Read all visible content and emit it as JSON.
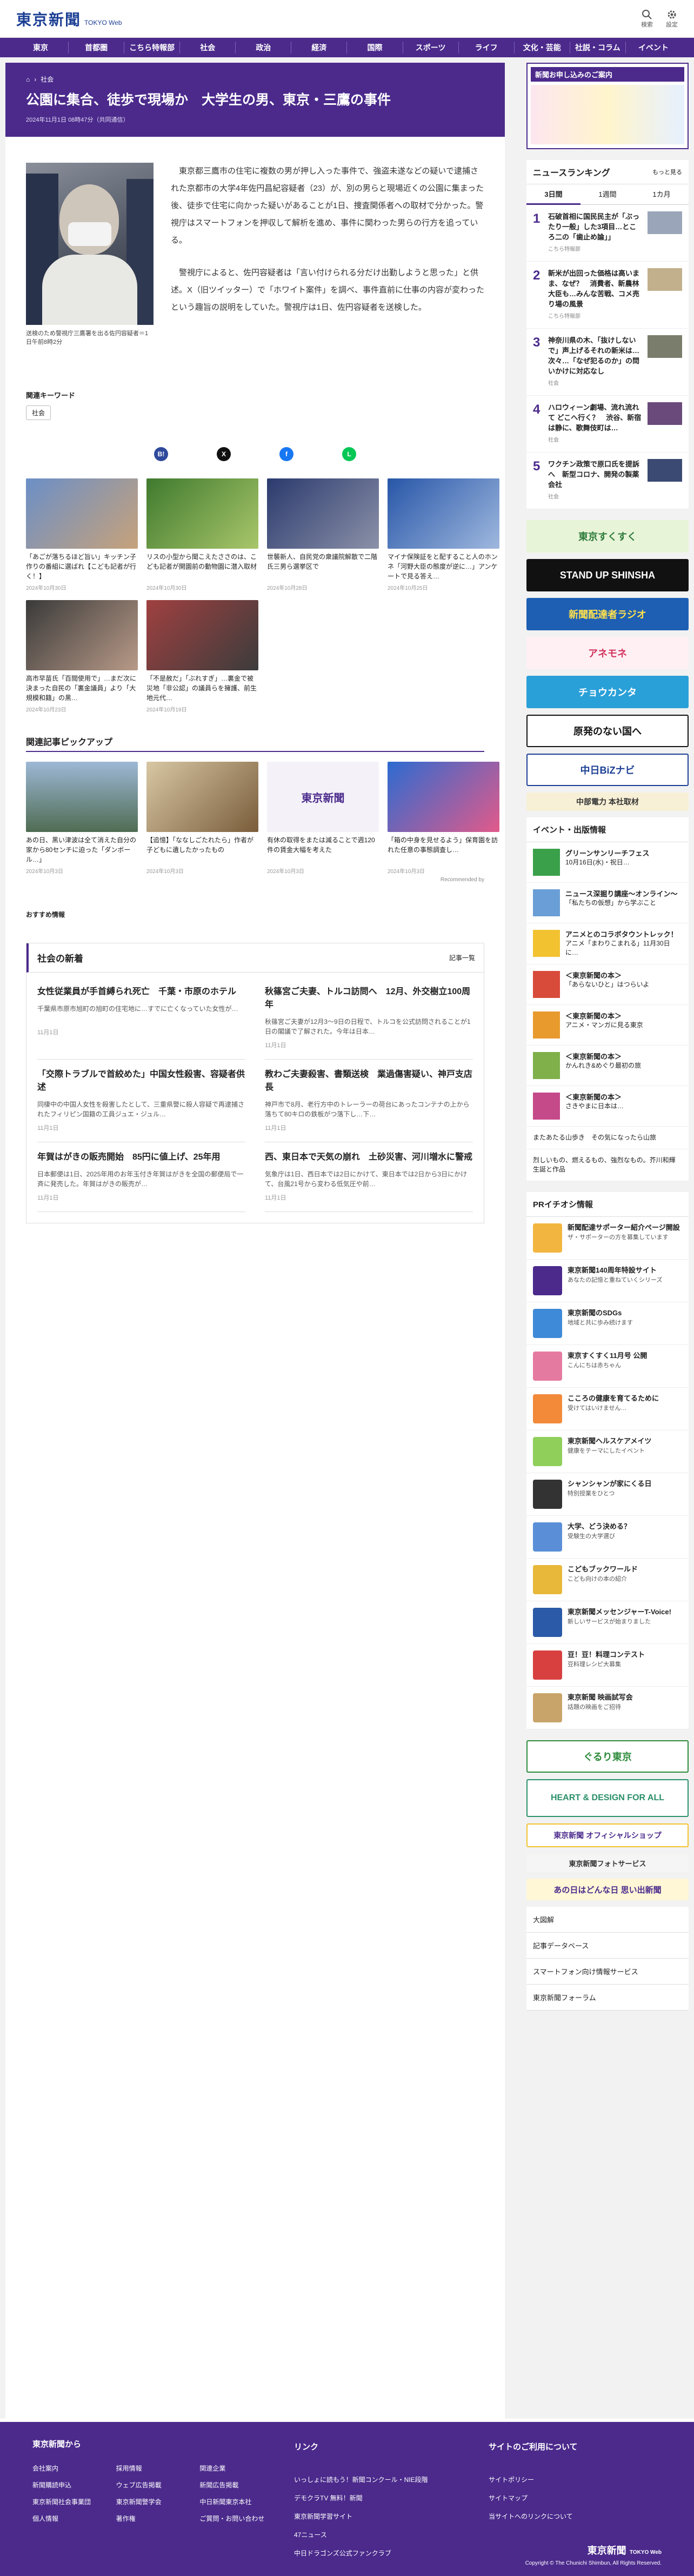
{
  "header": {
    "logo": "東京新聞",
    "logo_sub": "TOKYO Web",
    "search": "検索",
    "settings": "設定"
  },
  "nav": [
    "東京",
    "首都圏",
    "こちら特報部",
    "社会",
    "政治",
    "経済",
    "国際",
    "スポーツ",
    "ライフ",
    "文化・芸能",
    "社説・コラム",
    "イベント"
  ],
  "article": {
    "crumb_home": "ホーム",
    "crumb": "社会",
    "title": "公園に集合、徒歩で現場か　大学生の男、東京・三鷹の事件",
    "date": "2024年11月1日 08時47分（共同通信）",
    "caption": "送検のため警視庁三鷹署を出る佐円容疑者＝1日午前8時2分",
    "p1": "東京都三鷹市の住宅に複数の男が押し入った事件で、強盗未遂などの疑いで逮捕された京都市の大学4年佐円昌紀容疑者（23）が、別の男らと現場近くの公園に集まった後、徒歩で住宅に向かった疑いがあることが1日、捜査関係者への取材で分かった。警視庁はスマートフォンを押収して解析を進め、事件に関わった男らの行方を追っている。",
    "p2": "警視庁によると、佐円容疑者は「言い付けられる分だけ出勤しようと思った」と供述。X（旧ツイッター）で「ホワイト案件」を調べ、事件直前に仕事の内容が変わったという趣旨の説明をしていた。警視庁は1日、佐円容疑者を送検した。"
  },
  "keywords": {
    "heading": "関連キーワード",
    "tag": "社会"
  },
  "related": [
    {
      "t": "「あごが落ちるほど旨い」キッチン子作りの番組に選ばれ【こども記者が行く！】",
      "d": "2024年10月30日"
    },
    {
      "t": "リスの小型から聞こえたささのは、こども記者が開園前の動物園に潜入取材",
      "d": "2024年10月30日"
    },
    {
      "t": "世襲新人、自民党の衆議院解散で二階氏三男ら選挙区で",
      "d": "2024年10月28日"
    },
    {
      "t": "マイナ保険証をと配すること人のホンネ「河野大臣の態度が逆に…」アンケートで見る答え…",
      "d": "2024年10月25日"
    },
    {
      "t": "高市早苗氏「百閲使用で」…まだ次に決まった自民の「裏金議員」より「大規模和籍」の黒…",
      "d": "2024年10月23日"
    },
    {
      "t": "「不是赦だ」「ぶれすぎ」…裏金で被災地「非公認」の議員らを擁護、前生地元代…",
      "d": "2024年10月19日"
    }
  ],
  "pickup": {
    "heading": "関連記事ピックアップ",
    "items": [
      {
        "t": "あの日、黒い津波は全て消えた自分の家から80センチに迫った「ダンボール…」",
        "d": "2024年10月3日"
      },
      {
        "t": "【追憶】「ななしごたれたら」作者が子どもに遺したかったもの",
        "d": "2024年10月3日"
      },
      {
        "t": "有休の取得をまたは減ることで週120件の賃金大幅を考えた",
        "d": "2024年10月3日"
      },
      {
        "t": "「箱の中身を見せるよう」保育園を訪れた任意の事態調査し…",
        "d": "2024年10月3日"
      }
    ],
    "credit": "Recommended by"
  },
  "osusume": "おすすめ情報",
  "shakai": {
    "heading": "社会の新着",
    "more": "記事一覧",
    "items": [
      {
        "h": "女性従業員が手首縛られ死亡　千葉・市原のホテル",
        "p": "千葉県市原市旭町の旭町の住宅地に…すでに亡くなっていた女性が…",
        "d": "11月1日"
      },
      {
        "h": "秋篠宮ご夫妻、トルコ訪問へ　12月、外交樹立100周年",
        "p": "秋篠宮ご夫妻が12月3〜9日の日程で、トルコを公式訪問されることが1日の閣議で了解された。今年は日本…",
        "d": "11月1日"
      },
      {
        "h": "「交際トラブルで首絞めた」中国女性殺害、容疑者供述",
        "p": "同棲中の中国人女性を殺害したとして、三重県警に殺人容疑で再逮捕されたフィリピン国籍の工員ジュエ・ジュル…",
        "d": "11月1日"
      },
      {
        "h": "教わご夫妻殺害、書類送検　業過傷害疑い、神戸支店長",
        "p": "神戸市で8月、老行方中のトレーラーの荷台にあったコンテナの上から落ちて80キロの鉄板がつ落下し…下…",
        "d": "11月1日"
      },
      {
        "h": "年賀はがきの販売開始　85円に値上げ、25年用",
        "p": "日本郵便は1日、2025年用のお年玉付き年賀はがきを全国の郵便局で一斉に発売した。年賀はがきの販売が…",
        "d": "11月1日"
      },
      {
        "h": "西、東日本で天気の崩れ　土砂災害、河川増水に警戒",
        "p": "気象庁は1日、西日本では2日にかけて、東日本では2日から3日にかけて、台風21号から変わる低気圧や前…",
        "d": "11月1日"
      }
    ]
  },
  "side": {
    "ad_title": "新聞お申し込みのご案内",
    "ranking": "ニュースランキング",
    "ranking_more": "もっと見る",
    "tabs": [
      "3日間",
      "1週間",
      "1カ月"
    ],
    "rank": [
      {
        "t": "石破首相に国民民主が「ぶったり一般」した3項目…ところ二の「歯止め論」」",
        "c": "こちら特報部"
      },
      {
        "t": "新米が出回った価格は高いまま、なぜ？　消費者、新農林大臣も…みんな苦戦、コメ売り場の風景",
        "c": "こちら特報部"
      },
      {
        "t": "神奈川県の木、「抜けしないで」声上げるそれの新米は…次々…「なぜ犯るのか」の問いかけに対応なし",
        "c": "社会"
      },
      {
        "t": "ハロウィーン劇場、流れ流れて どこへ行く？　渋谷、新宿は静に、歌舞伎町は…",
        "c": "社会"
      },
      {
        "t": "ワクチン政策で原口氏を提訴へ　新型コロナ、開発の製薬会社",
        "c": "社会"
      }
    ],
    "banners": [
      "東京すくすく",
      "STAND UP SHINSHA",
      "新聞配達者ラジオ",
      "アネモネ",
      "チョウカンタ",
      "原発のない国へ",
      "中日BiZナビ",
      "中部電力 本社取材"
    ],
    "events_h": "イベント・出版情報",
    "events": [
      {
        "b": "グリーンサンリーチフェス",
        "s": "10月16日(水)・祝日…"
      },
      {
        "b": "ニュース深掘り講座～オンライン～",
        "s": "「私たちの仮想」から学ぶこと"
      },
      {
        "b": "アニメとのコラボタウントレック！",
        "s": "アニメ「まわりこまれる」11月30日に…"
      },
      {
        "b": "＜東京新聞の本＞",
        "s": "「あらないひと」はつらいよ"
      },
      {
        "b": "＜東京新聞の本＞",
        "s": "アニメ・マンガに見る東京"
      },
      {
        "b": "＜東京新聞の本＞",
        "s": "かんれき&めぐり最初の旅"
      },
      {
        "b": "＜東京新聞の本＞",
        "s": "さきやまに日本は…"
      }
    ],
    "ev_more1": "またあたる山歩き　その気になったら山旅",
    "ev_more2": "烈しいもの、燃えるもの、強烈なもの。芥川和輝　生誕と作品",
    "pr_h": "PRイチオシ情報",
    "pr": [
      {
        "b": "新聞配達サポーター紹介ページ開設",
        "s": "ザ・サポーターの方を募集しています"
      },
      {
        "b": "東京新聞140周年特設サイト",
        "s": "あなたの記憶と重ねていくシリーズ"
      },
      {
        "b": "東京新聞のSDGs",
        "s": "地域と共に歩み続けます"
      },
      {
        "b": "東京すくすく11月号 公開",
        "s": "こんにちは赤ちゃん"
      },
      {
        "b": "こころの健康を育てるために",
        "s": "受けてはいけません…"
      },
      {
        "b": "東京新聞ヘルスケアメイツ",
        "s": "健康をテーマにしたイベント"
      },
      {
        "b": "シャンシャンが家にくる日",
        "s": "特別授業をひとつ"
      },
      {
        "b": "大学、どう決める？",
        "s": "受験生の大学選び"
      },
      {
        "b": "こどもブックワールド",
        "s": "こども向けの本の紹介"
      },
      {
        "b": "東京新聞メッセンジャーT-Voice!",
        "s": "新しいサービスが始まりました"
      },
      {
        "b": "豆！豆！料理コンテスト",
        "s": "豆料理レシピ大募集"
      },
      {
        "b": "東京新聞 映画試写会",
        "s": "話題の映画をご招待"
      }
    ],
    "bottom_banners": [
      "ぐるり東京",
      "HEART & DESIGN FOR ALL",
      "東京新聞 オフィシャルショップ",
      "東京新聞フォトサービス",
      "あの日はどんな日 思い出新聞"
    ],
    "links": [
      "大図解",
      "記事データベース",
      "スマートフォン向け情報サービス",
      "東京新聞フォーラム"
    ]
  },
  "footer": {
    "h1": "東京新聞から",
    "h2": "リンク",
    "h3": "サイトのご利用について",
    "c1": [
      "会社案内",
      "採用情報",
      "関連企業",
      "新聞購読申込",
      "ウェブ広告掲載",
      "新聞広告掲載",
      "東京新聞社会事業団",
      "東京新聞警学会",
      "中日新聞東京本社",
      "個人情報",
      "著作権",
      "ご質問・お問い合わせ"
    ],
    "c2": [
      "いっしょに読もう！新聞コンクール・NIE段階",
      "デモクラTV 無料！新聞",
      "東京新聞学習サイト",
      "47ニュース",
      "中日ドラゴンズ公式ファンクラブ"
    ],
    "c3": [
      "サイトポリシー",
      "サイトマップ",
      "当サイトへのリンクについて"
    ],
    "copyright": "Copyright © The Chunichi Shimbun, All Rights Reserved."
  },
  "colors": {
    "brand": "#4b2a8c"
  }
}
